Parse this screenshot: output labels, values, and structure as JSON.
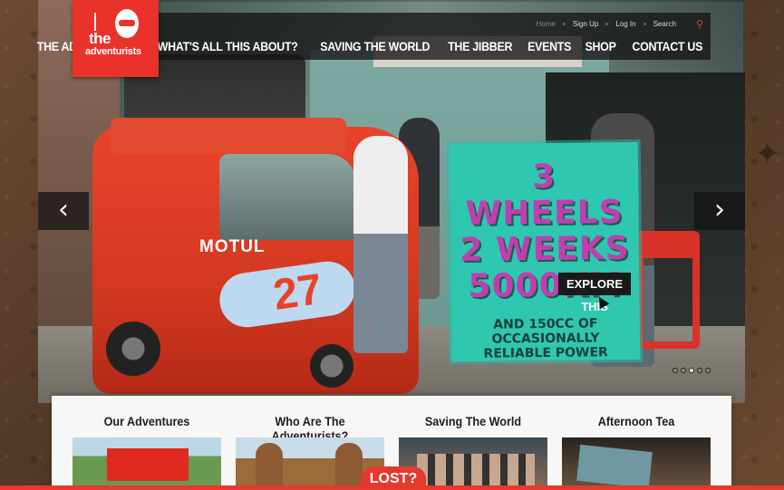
{
  "brand": {
    "logo_the": "the",
    "logo_name": "adventurists"
  },
  "utility_nav": [
    {
      "label": "Home"
    },
    {
      "label": "Sign Up"
    },
    {
      "label": "Log In"
    },
    {
      "label": "Search"
    }
  ],
  "main_nav": [
    {
      "label": "THE ADVENTURES"
    },
    {
      "label": "WHAT'S ALL THIS ABOUT?"
    },
    {
      "label": "SAVING THE WORLD"
    },
    {
      "label": "THE JIBBER"
    },
    {
      "label": "EVENTS"
    },
    {
      "label": "SHOP"
    },
    {
      "label": "CONTACT US"
    }
  ],
  "hero": {
    "promo_line1": "3 WHEELS",
    "promo_line2": "2 WEEKS",
    "promo_line3": "5000KM",
    "promo_sub1": "AND 150CC OF",
    "promo_sub2": "OCCASIONALLY",
    "promo_sub3": "RELIABLE POWER",
    "tuk_brand": "MOTUL",
    "tuk_number": "27",
    "cta": "EXPLORE THIS",
    "prev_icon": "chevron-left-icon",
    "next_icon": "chevron-right-icon",
    "prev_glyph": "‹",
    "next_glyph": "›",
    "slides_total": 5,
    "slide_active": 3
  },
  "sections": [
    {
      "title": "Our Adventures"
    },
    {
      "title": "Who Are The Adventurists?"
    },
    {
      "title": "Saving The World"
    },
    {
      "title": "Afternoon Tea"
    }
  ],
  "lost_tab": "LOST?",
  "colors": {
    "brand_red": "#e8322a",
    "promo_teal": "#2fc7b0",
    "promo_purple": "#bf3fb0"
  }
}
